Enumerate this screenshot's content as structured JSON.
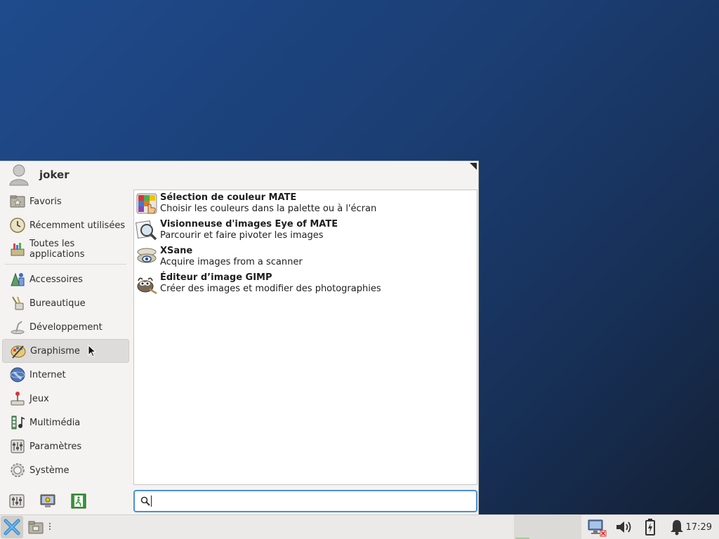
{
  "user": {
    "name": "joker"
  },
  "categories": [
    {
      "label": "Favoris",
      "icon": "favorites-folder-icon"
    },
    {
      "label": "Récemment utilisées",
      "icon": "recent-clock-icon"
    },
    {
      "label": "Toutes les applications",
      "icon": "all-applications-icon"
    },
    {
      "label": "Accessoires",
      "icon": "accessories-icon"
    },
    {
      "label": "Bureautique",
      "icon": "office-icon"
    },
    {
      "label": "Développement",
      "icon": "development-icon"
    },
    {
      "label": "Graphisme",
      "icon": "graphics-icon",
      "active": true
    },
    {
      "label": "Internet",
      "icon": "internet-globe-icon"
    },
    {
      "label": "Jeux",
      "icon": "games-joystick-icon"
    },
    {
      "label": "Multimédia",
      "icon": "multimedia-icon"
    },
    {
      "label": "Paramètres",
      "icon": "settings-icon"
    },
    {
      "label": "Système",
      "icon": "system-gear-icon"
    }
  ],
  "applications": [
    {
      "name": "Sélection de couleur MATE",
      "description": "Choisir les couleurs dans la palette ou à l'écran",
      "icon": "color-picker-icon"
    },
    {
      "name": "Visionneuse d'images Eye of MATE",
      "description": "Parcourir et faire pivoter les images",
      "icon": "image-viewer-icon"
    },
    {
      "name": "XSane",
      "description": "Acquire images from a scanner",
      "icon": "scanner-icon"
    },
    {
      "name": "Éditeur d’image GIMP",
      "description": "Créer des images et modifier des photographies",
      "icon": "gimp-icon"
    }
  ],
  "search": {
    "value": "",
    "placeholder": ""
  },
  "panel": {
    "clock": "17:29"
  },
  "colors": {
    "search_focus": "#4a90d9",
    "desktop": "#1f4b8c"
  }
}
